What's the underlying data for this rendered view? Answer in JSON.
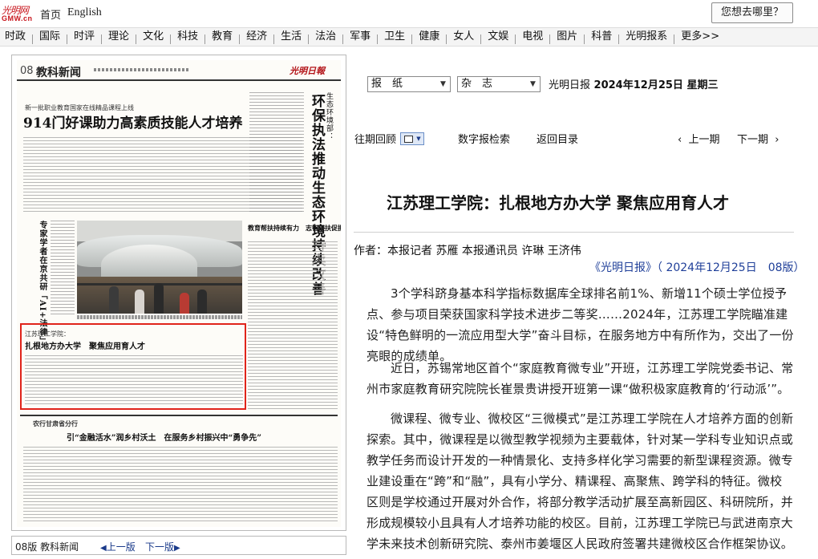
{
  "topbar": {
    "logo_text": "光明网",
    "logo_sub": "GMW.cn",
    "home_label": "首页",
    "english_label": "English",
    "where_button": "您想去哪里？"
  },
  "nav": {
    "items": [
      "时政",
      "国际",
      "时评",
      "理论",
      "文化",
      "科技",
      "教育",
      "经济",
      "生活",
      "法治",
      "军事",
      "卫生",
      "健康",
      "女人",
      "文娱",
      "电视",
      "图片",
      "科普",
      "光明报系",
      "更多>>"
    ]
  },
  "newspaper": {
    "page_number": "08",
    "section": "教科新闻",
    "masthead": "光明日報",
    "lead_kicker": "新一批职业教育国家在线精品课程上线",
    "lead_headline": "914门好课助力高素质技能人才培养",
    "vertical_headline": "环保执法推动生态环境持续改善",
    "vertical_kicker": "生态环境部：",
    "side_vertical_headline": "专家学者在京共研「AI+法律」",
    "mid_headline": "教育帮扶持续有力　志智双扶促振兴",
    "highlight_kicker": "江苏理工学院：",
    "highlight_headline": "扎根地方办大学　聚焦应用育人才",
    "bottom_kicker": "农行甘肃省分行",
    "bottom_headline": "引“金融活水”润乡村沃土　在服务乡村振兴中“勇争先”"
  },
  "left_footer": {
    "edition": "08版 教科新闻",
    "prev": "上一版",
    "next": "下一版"
  },
  "selectors": {
    "paper_value": "报　纸",
    "magazine_value": "杂　志",
    "publication": "光明日报",
    "date": "2024年12月25日",
    "weekday": "星期三"
  },
  "tools": {
    "archive": "往期回顾",
    "search": "数字报检索",
    "back_to_toc": "返回目录",
    "prev_issue": "上一期",
    "next_issue": "下一期"
  },
  "article": {
    "title": "江苏理工学院：扎根地方办大学 聚焦应用育人才",
    "byline": "作者：本报记者 苏雁 本报通讯员 许琳 王济伟",
    "source": "《光明日报》（ 2024年12月25日　08版）",
    "paragraphs": [
      "3个学科跻身基本科学指标数据库全球排名前1%、新增11个硕士学位授予点、参与项目荣获国家科学技术进步二等奖……2024年，江苏理工学院瞄准建设“特色鲜明的一流应用型大学”奋斗目标，在服务地方中有所作为，交出了一份亮眼的成绩单。",
      "近日，苏锡常地区首个“家庭教育微专业”开班，江苏理工学院党委书记、常州市家庭教育研究院院长崔景贵讲授开班第一课“做积极家庭教育的‘行动派’”。",
      "微课程、微专业、微校区“三微模式”是江苏理工学院在人才培养方面的创新探索。其中，微课程是以微型教学视频为主要载体，针对某一学科专业知识点或教学任务而设计开发的一种情景化、支持多样化学习需要的新型课程资源。微专业建设重在“跨”和“融”，具有小学分、精课程、高聚焦、跨学科的特征。微校区则是学校通过开展对外合作，将部分教学活动扩展至高新园区、科研院所，并形成规模较小且具有人才培养功能的校区。目前，江苏理工学院已与武进南京大学未来技术创新研究院、泰州市姜堰区人民政府签署共建微校区合作框架协议。"
    ]
  }
}
